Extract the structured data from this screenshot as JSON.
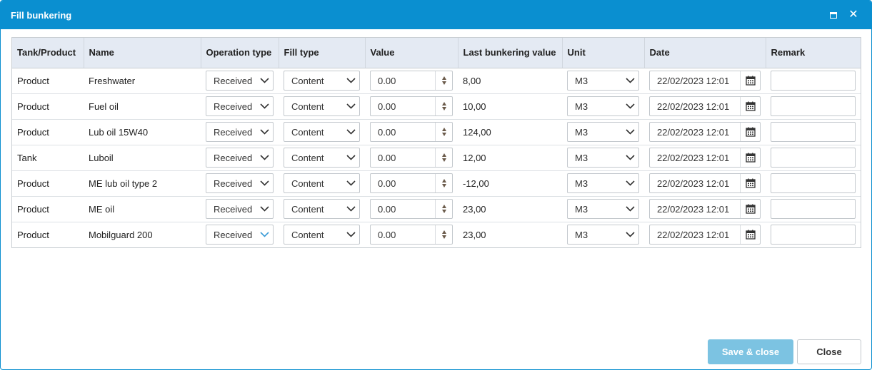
{
  "window": {
    "title": "Fill bunkering"
  },
  "table": {
    "headers": [
      "Tank/Product",
      "Name",
      "Operation type",
      "Fill type",
      "Value",
      "Last bunkering value",
      "Unit",
      "Date",
      "Remark"
    ],
    "rows": [
      {
        "type": "Product",
        "name": "Freshwater",
        "operation": "Received",
        "fill": "Content",
        "value": "0.00",
        "last": "8,00",
        "unit": "M3",
        "date": "22/02/2023 12:01",
        "remark": ""
      },
      {
        "type": "Product",
        "name": "Fuel oil",
        "operation": "Received",
        "fill": "Content",
        "value": "0.00",
        "last": "10,00",
        "unit": "M3",
        "date": "22/02/2023 12:01",
        "remark": ""
      },
      {
        "type": "Product",
        "name": "Lub oil 15W40",
        "operation": "Received",
        "fill": "Content",
        "value": "0.00",
        "last": "124,00",
        "unit": "M3",
        "date": "22/02/2023 12:01",
        "remark": ""
      },
      {
        "type": "Tank",
        "name": "Luboil",
        "operation": "Received",
        "fill": "Content",
        "value": "0.00",
        "last": "12,00",
        "unit": "M3",
        "date": "22/02/2023 12:01",
        "remark": ""
      },
      {
        "type": "Product",
        "name": "ME lub oil type 2",
        "operation": "Received",
        "fill": "Content",
        "value": "0.00",
        "last": "-12,00",
        "unit": "M3",
        "date": "22/02/2023 12:01",
        "remark": ""
      },
      {
        "type": "Product",
        "name": "ME oil",
        "operation": "Received",
        "fill": "Content",
        "value": "0.00",
        "last": "23,00",
        "unit": "M3",
        "date": "22/02/2023 12:01",
        "remark": ""
      },
      {
        "type": "Product",
        "name": "Mobilguard 200",
        "operation": "Received",
        "fill": "Content",
        "value": "0.00",
        "last": "23,00",
        "unit": "M3",
        "date": "22/02/2023 12:01",
        "remark": ""
      }
    ]
  },
  "footer": {
    "save_label": "Save & close",
    "close_label": "Close"
  },
  "colors": {
    "accent": "#0a8fd0",
    "save_button": "#7cc3e2",
    "header_bg": "#e4eaf3",
    "focused_chevron": "#3a9bd6"
  },
  "icons": {
    "maximize": "maximize-icon",
    "close": "close-icon",
    "dropdown": "chevron-down-icon",
    "spinner": "spinner-arrows-icon",
    "calendar": "calendar-icon"
  }
}
